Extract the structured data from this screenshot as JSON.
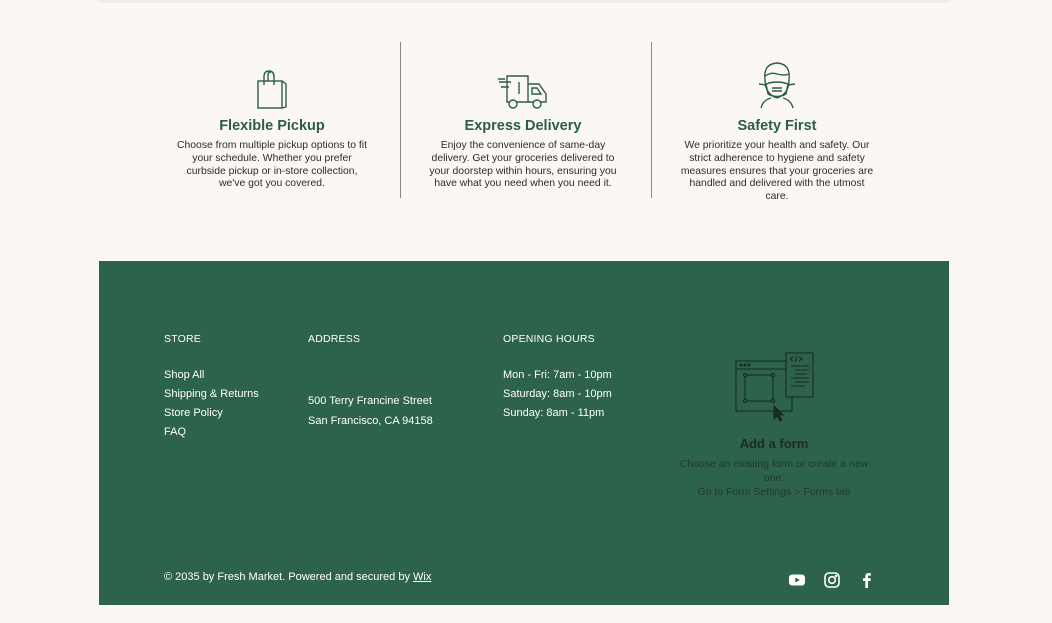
{
  "features": [
    {
      "icon": "shopping-bag-icon",
      "title": "Flexible Pickup",
      "text": "Choose from multiple pickup options to fit your schedule. Whether you prefer curbside pickup or in-store collection, we've got you covered."
    },
    {
      "icon": "delivery-truck-icon",
      "title": "Express Delivery",
      "text": "Enjoy the convenience of same-day delivery. Get your groceries delivered to your doorstep within hours, ensuring you have what you need when you need it."
    },
    {
      "icon": "face-mask-icon",
      "title": "Safety First",
      "text": "We prioritize your health and safety. Our strict adherence to hygiene and safety measures ensures that your groceries are handled and delivered with the utmost care."
    }
  ],
  "footer": {
    "store": {
      "heading": "STORE",
      "links": [
        "Shop All",
        "Shipping & Returns",
        "Store Policy",
        "FAQ"
      ]
    },
    "address": {
      "heading": "ADDRESS",
      "line1": "500 Terry Francine Street",
      "line2": "San Francisco, CA 94158"
    },
    "hours": {
      "heading": "OPENING HOURS",
      "lines": [
        "Mon - Fri: 7am - 10pm",
        "Saturday: 8am - 10pm",
        "Sunday: 8am - 11pm"
      ]
    },
    "form": {
      "title": "Add a form",
      "desc1": "Choose an existing form or create a new one.",
      "desc2": "Go to Form Settings > Forms tab"
    },
    "copyright": {
      "text": "© 2035 by Fresh Market. Powered and secured by ",
      "link": "Wix"
    },
    "social": [
      "youtube-icon",
      "instagram-icon",
      "facebook-icon"
    ]
  },
  "colors": {
    "background": "#fbf8f3",
    "footer": "#2d624c",
    "accent": "#2b5e47"
  }
}
